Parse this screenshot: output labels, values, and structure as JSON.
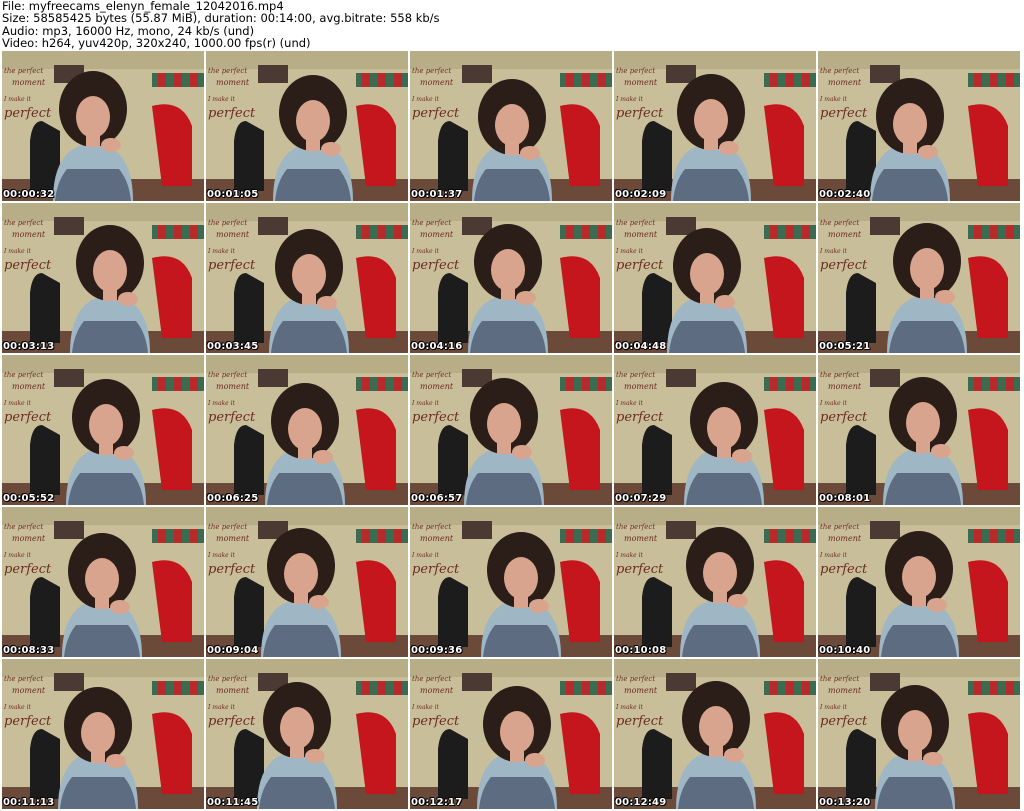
{
  "header": {
    "file_line": "File: myfreecams_elenyn_female_12042016.mp4",
    "size_line": "Size: 58585425 bytes (55.87 MiB), duration: 00:14:00, avg.bitrate: 558 kb/s",
    "audio_line": "Audio: mp3, 16000 Hz, mono, 24 kb/s (und)",
    "video_line": "Video: h264, yuv420p, 320x240, 1000.00 fps(r) (und)"
  },
  "wall_text": [
    "the perfect",
    "moment",
    "I make it",
    "perfect"
  ],
  "colors": {
    "wall": "#c8bf9a",
    "shelf": "#4a3a33",
    "chair_red": "#c4161c",
    "chair_black": "#1c1c1c",
    "hair": "#2b1d18",
    "skin": "#d9a48d",
    "dress": "#9fb6c4",
    "floor": "#6b4a3a"
  },
  "thumbnails": [
    {
      "timestamp": "00:00:32"
    },
    {
      "timestamp": "00:01:05"
    },
    {
      "timestamp": "00:01:37"
    },
    {
      "timestamp": "00:02:09"
    },
    {
      "timestamp": "00:02:40"
    },
    {
      "timestamp": "00:03:13"
    },
    {
      "timestamp": "00:03:45"
    },
    {
      "timestamp": "00:04:16"
    },
    {
      "timestamp": "00:04:48"
    },
    {
      "timestamp": "00:05:21"
    },
    {
      "timestamp": "00:05:52"
    },
    {
      "timestamp": "00:06:25"
    },
    {
      "timestamp": "00:06:57"
    },
    {
      "timestamp": "00:07:29"
    },
    {
      "timestamp": "00:08:01"
    },
    {
      "timestamp": "00:08:33"
    },
    {
      "timestamp": "00:09:04"
    },
    {
      "timestamp": "00:09:36"
    },
    {
      "timestamp": "00:10:08"
    },
    {
      "timestamp": "00:10:40"
    },
    {
      "timestamp": "00:11:13"
    },
    {
      "timestamp": "00:11:45"
    },
    {
      "timestamp": "00:12:17"
    },
    {
      "timestamp": "00:12:49"
    },
    {
      "timestamp": "00:13:20"
    }
  ]
}
